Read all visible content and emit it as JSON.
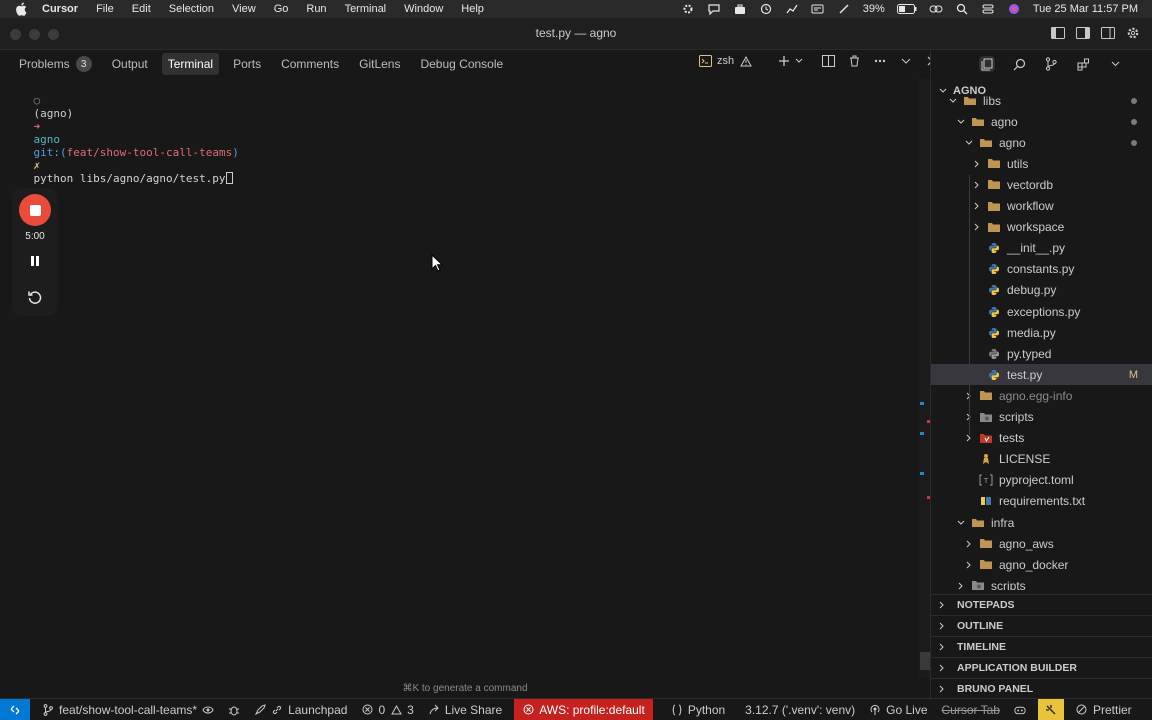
{
  "menubar": {
    "app_name": "Cursor",
    "items": [
      "File",
      "Edit",
      "Selection",
      "View",
      "Go",
      "Run",
      "Terminal",
      "Window",
      "Help"
    ],
    "battery": "39%",
    "clock": "Tue 25 Mar  11:57 PM"
  },
  "window": {
    "title": "test.py — agno"
  },
  "panel": {
    "tabs": [
      {
        "label": "Problems",
        "badge": "3"
      },
      {
        "label": "Output"
      },
      {
        "label": "Terminal",
        "active": true
      },
      {
        "label": "Ports"
      },
      {
        "label": "Comments"
      },
      {
        "label": "GitLens"
      },
      {
        "label": "Debug Console"
      }
    ],
    "shell_label": "zsh"
  },
  "terminal": {
    "dot": "○",
    "env": "(agno)",
    "arrow": "➜",
    "dir": "agno",
    "git_prefix": "git:(",
    "branch": "feat/show-tool-call-teams",
    "git_suffix": ")",
    "dirty_mark": "✗",
    "command": "python libs/agno/agno/test.py",
    "hint": "⌘K to generate a command"
  },
  "recorder": {
    "time": "5:00"
  },
  "explorer": {
    "root": "AGNO",
    "rows": [
      {
        "label": "libs",
        "depth": 1,
        "type": "folder-open",
        "dot": true
      },
      {
        "label": "agno",
        "depth": 2,
        "type": "folder-open",
        "dot": true
      },
      {
        "label": "agno",
        "depth": 3,
        "type": "folder-open",
        "dot": true
      },
      {
        "label": "utils",
        "depth": 4,
        "type": "folder",
        "partial": true
      },
      {
        "label": "vectordb",
        "depth": 4,
        "type": "folder"
      },
      {
        "label": "workflow",
        "depth": 4,
        "type": "folder"
      },
      {
        "label": "workspace",
        "depth": 4,
        "type": "folder"
      },
      {
        "label": "__init__.py",
        "depth": 4,
        "type": "python"
      },
      {
        "label": "constants.py",
        "depth": 4,
        "type": "python"
      },
      {
        "label": "debug.py",
        "depth": 4,
        "type": "python"
      },
      {
        "label": "exceptions.py",
        "depth": 4,
        "type": "python"
      },
      {
        "label": "media.py",
        "depth": 4,
        "type": "python"
      },
      {
        "label": "py.typed",
        "depth": 4,
        "type": "python-grey"
      },
      {
        "label": "test.py",
        "depth": 4,
        "type": "python",
        "selected": true,
        "mark": "M"
      },
      {
        "label": "agno.egg-info",
        "depth": 3,
        "type": "folder",
        "dim": true
      },
      {
        "label": "scripts",
        "depth": 3,
        "type": "folder-special"
      },
      {
        "label": "tests",
        "depth": 3,
        "type": "folder-tests"
      },
      {
        "label": "LICENSE",
        "depth": 3,
        "type": "license"
      },
      {
        "label": "pyproject.toml",
        "depth": 3,
        "type": "toml"
      },
      {
        "label": "requirements.txt",
        "depth": 3,
        "type": "txt"
      },
      {
        "label": "infra",
        "depth": 2,
        "type": "folder-open"
      },
      {
        "label": "agno_aws",
        "depth": 3,
        "type": "folder"
      },
      {
        "label": "agno_docker",
        "depth": 3,
        "type": "folder"
      },
      {
        "label": "scripts",
        "depth": 2,
        "type": "folder-special",
        "partial": true
      }
    ],
    "sections": [
      "NOTEPADS",
      "OUTLINE",
      "TIMELINE",
      "APPLICATION BUILDER",
      "BRUNO PANEL"
    ]
  },
  "statusbar": {
    "branch": "feat/show-tool-call-teams*",
    "launchpad": "Launchpad",
    "errors": "0",
    "warnings": "3",
    "live_share": "Live Share",
    "aws": "AWS: profile:default",
    "language": "Python",
    "interpreter": "3.12.7 ('.venv': venv)",
    "go_live": "Go Live",
    "cursor_tab": "Cursor Tab",
    "prettier": "Prettier"
  },
  "colors": {
    "accent_blue": "#0078d4",
    "aws_red": "#c5221f",
    "record_red": "#ea4c3c",
    "branch_red": "#e06c75"
  }
}
